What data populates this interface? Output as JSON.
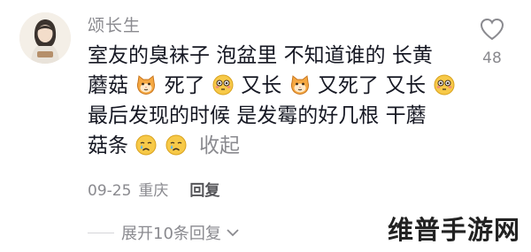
{
  "comment": {
    "username": "颂长生",
    "lines": [
      [
        "室友的臭袜子 泡盆里 不知道谁的 长黄"
      ],
      [
        "蘑菇",
        "死了",
        "又长",
        "又死了 又长"
      ],
      [
        "最后发现的时候 是发霉的好几根 干蘑"
      ],
      [
        "菇条",
        "收起"
      ]
    ],
    "emojis": {
      "cat": "cat-face-emoji",
      "flushed": "flushed-face-emoji",
      "crying": "crying-face-emoji"
    },
    "date": "09-25",
    "location": "重庆",
    "reply_label": "回复",
    "like_count": "48"
  },
  "thread": {
    "expand_label": "展开10条回复"
  },
  "watermark": "维普手游网",
  "colors": {
    "text": "#161823",
    "muted": "#8a8a8f",
    "emoji_face": "#f7c948"
  }
}
